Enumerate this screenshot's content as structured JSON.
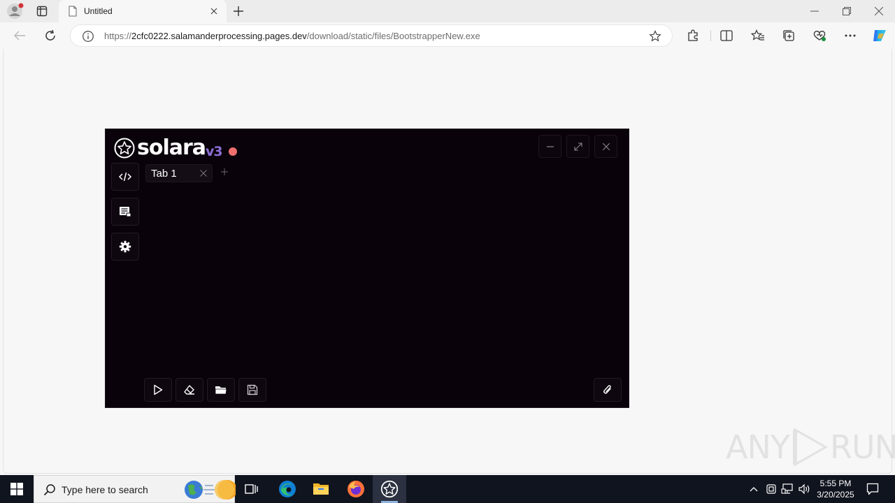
{
  "browser": {
    "tab": {
      "title": "Untitled"
    },
    "url": {
      "prefix": "https://",
      "host": "2cfc0222.salamanderprocessing.pages.dev",
      "path": "/download/static/files/BootstrapperNew.exe"
    }
  },
  "solara": {
    "logo": {
      "name": "solara",
      "version": "v3"
    },
    "status_color": "#ef6f6f",
    "editor_tabs": [
      {
        "label": "Tab 1"
      }
    ]
  },
  "watermark": {
    "left": "ANY",
    "right": "RUN"
  },
  "taskbar": {
    "search_placeholder": "Type here to search",
    "clock": {
      "time": "5:55 PM",
      "date": "3/20/2025"
    }
  }
}
